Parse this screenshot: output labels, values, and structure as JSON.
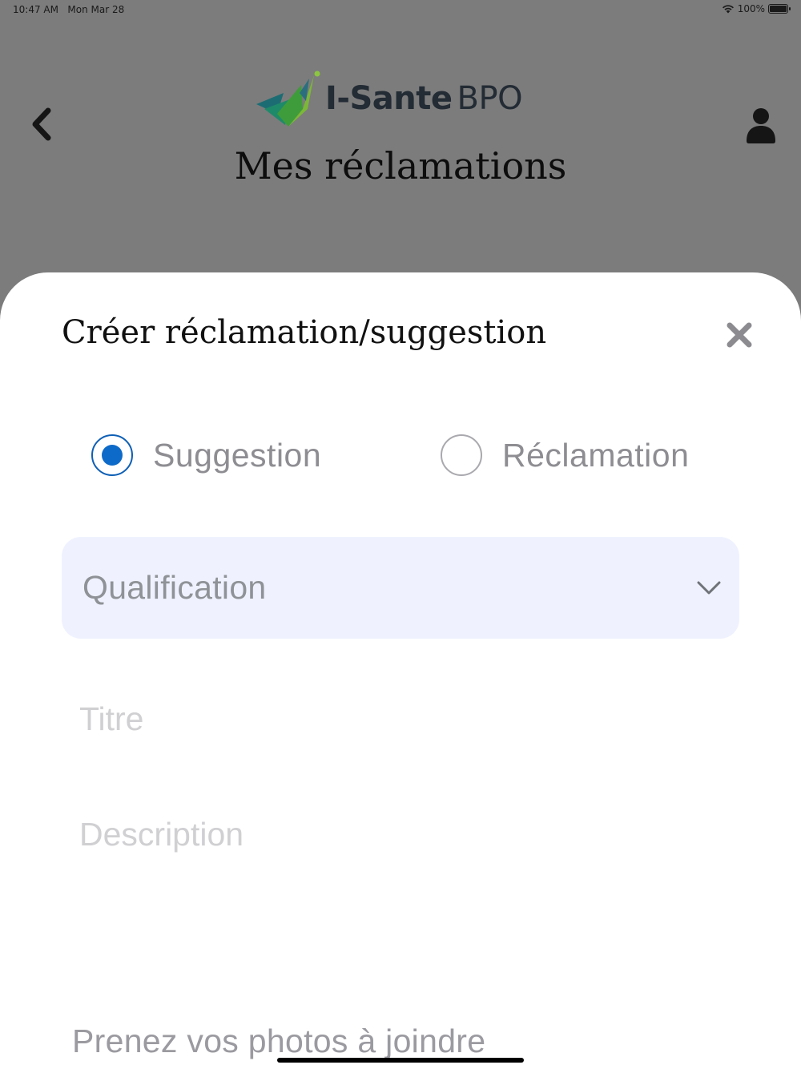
{
  "status_bar": {
    "time": "10:47 AM",
    "date": "Mon Mar 28",
    "battery": "100%",
    "battery_level": 1.0,
    "icons": [
      "wifi-icon",
      "battery-icon"
    ]
  },
  "header": {
    "logo": {
      "brand": "I-Sante",
      "suffix": "BPO"
    },
    "title": "Mes réclamations",
    "icons": [
      "chevron-left-icon",
      "user-icon"
    ]
  },
  "sheet": {
    "title": "Créer réclamation/suggestion",
    "close_icon": "close-icon",
    "type_options": [
      {
        "label": "Suggestion",
        "selected": true
      },
      {
        "label": "Réclamation",
        "selected": false
      }
    ],
    "qualification": {
      "label": "Qualification",
      "icon": "chevron-down-icon"
    },
    "title_field": {
      "placeholder": "Titre",
      "value": ""
    },
    "description_field": {
      "placeholder": "Description",
      "value": ""
    },
    "photos_label": "Prenez vos photos à joindre"
  },
  "colors": {
    "overlay": "#7c7c7c",
    "accent": "#0e6ac8",
    "select_bg": "#eff2fe",
    "logo_dark": "#232b34"
  }
}
